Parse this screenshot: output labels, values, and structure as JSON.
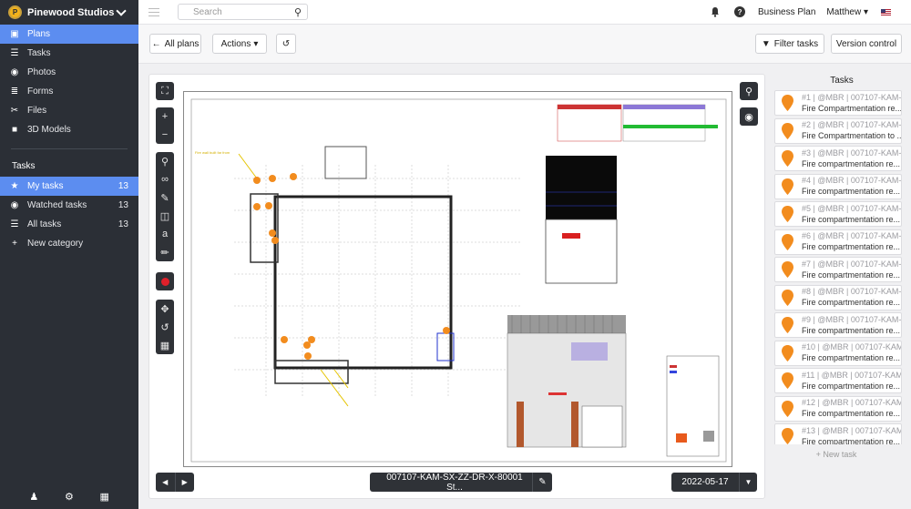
{
  "sidebar": {
    "org_name": "Pinewood Studios",
    "nav": [
      {
        "label": "Plans",
        "icon": "plans-icon",
        "glyph": "▣"
      },
      {
        "label": "Tasks",
        "icon": "tasks-icon",
        "glyph": "☰"
      },
      {
        "label": "Photos",
        "icon": "camera-icon",
        "glyph": "◉"
      },
      {
        "label": "Forms",
        "icon": "forms-icon",
        "glyph": "≣"
      },
      {
        "label": "Files",
        "icon": "paperclip-icon",
        "glyph": "✂"
      },
      {
        "label": "3D Models",
        "icon": "cube-icon",
        "glyph": "■"
      }
    ],
    "tasks_section_title": "Tasks",
    "task_filters": [
      {
        "label": "My tasks",
        "count": "13",
        "icon": "star-icon",
        "glyph": "★"
      },
      {
        "label": "Watched tasks",
        "count": "13",
        "icon": "eye-icon",
        "glyph": "◉"
      },
      {
        "label": "All tasks",
        "count": "13",
        "icon": "list-icon",
        "glyph": "☰"
      },
      {
        "label": "New category",
        "count": "",
        "icon": "plus-icon",
        "glyph": "+"
      }
    ]
  },
  "topbar": {
    "search_placeholder": "Search",
    "plan_name": "Business Plan",
    "user_name": "Matthew"
  },
  "toolbar": {
    "all_plans_label": "All plans",
    "actions_label": "Actions",
    "filter_tasks_label": "Filter tasks",
    "version_control_label": "Version control"
  },
  "viewer": {
    "document_name": "007107-KAM-SX-ZZ-DR-X-80001 St...",
    "revision_date": "2022-05-17"
  },
  "tasks_panel": {
    "title": "Tasks",
    "new_task_label": "+ New task",
    "pin_color": "#f28c1e",
    "items": [
      {
        "id": "#1 | @MBR | 007107-KAM-S...",
        "title": "Fire Compartmentation re..."
      },
      {
        "id": "#2 | @MBR | 007107-KAM-S...",
        "title": "Fire Compartmentation to ..."
      },
      {
        "id": "#3 | @MBR | 007107-KAM-S...",
        "title": "Fire compartmentation re..."
      },
      {
        "id": "#4 | @MBR | 007107-KAM-S...",
        "title": "Fire compartmentation re..."
      },
      {
        "id": "#5 | @MBR | 007107-KAM-S...",
        "title": "Fire compartmentation re..."
      },
      {
        "id": "#6 | @MBR | 007107-KAM-S...",
        "title": "Fire compartmentation re..."
      },
      {
        "id": "#7 | @MBR | 007107-KAM-S...",
        "title": "Fire compartmentation re..."
      },
      {
        "id": "#8 | @MBR | 007107-KAM-S...",
        "title": "Fire compartmentation re..."
      },
      {
        "id": "#9 | @MBR | 007107-KAM-S...",
        "title": "Fire compartmentation re..."
      },
      {
        "id": "#10 | @MBR | 007107-KAM-...",
        "title": "Fire compartmentation re..."
      },
      {
        "id": "#11 | @MBR | 007107-KAM-...",
        "title": "Fire compartmentation re..."
      },
      {
        "id": "#12 | @MBR | 007107-KAM-...",
        "title": "Fire compartmentation re..."
      },
      {
        "id": "#13 | @MBR | 007107-KAM-...",
        "title": "Fire compartmentation re..."
      }
    ]
  }
}
